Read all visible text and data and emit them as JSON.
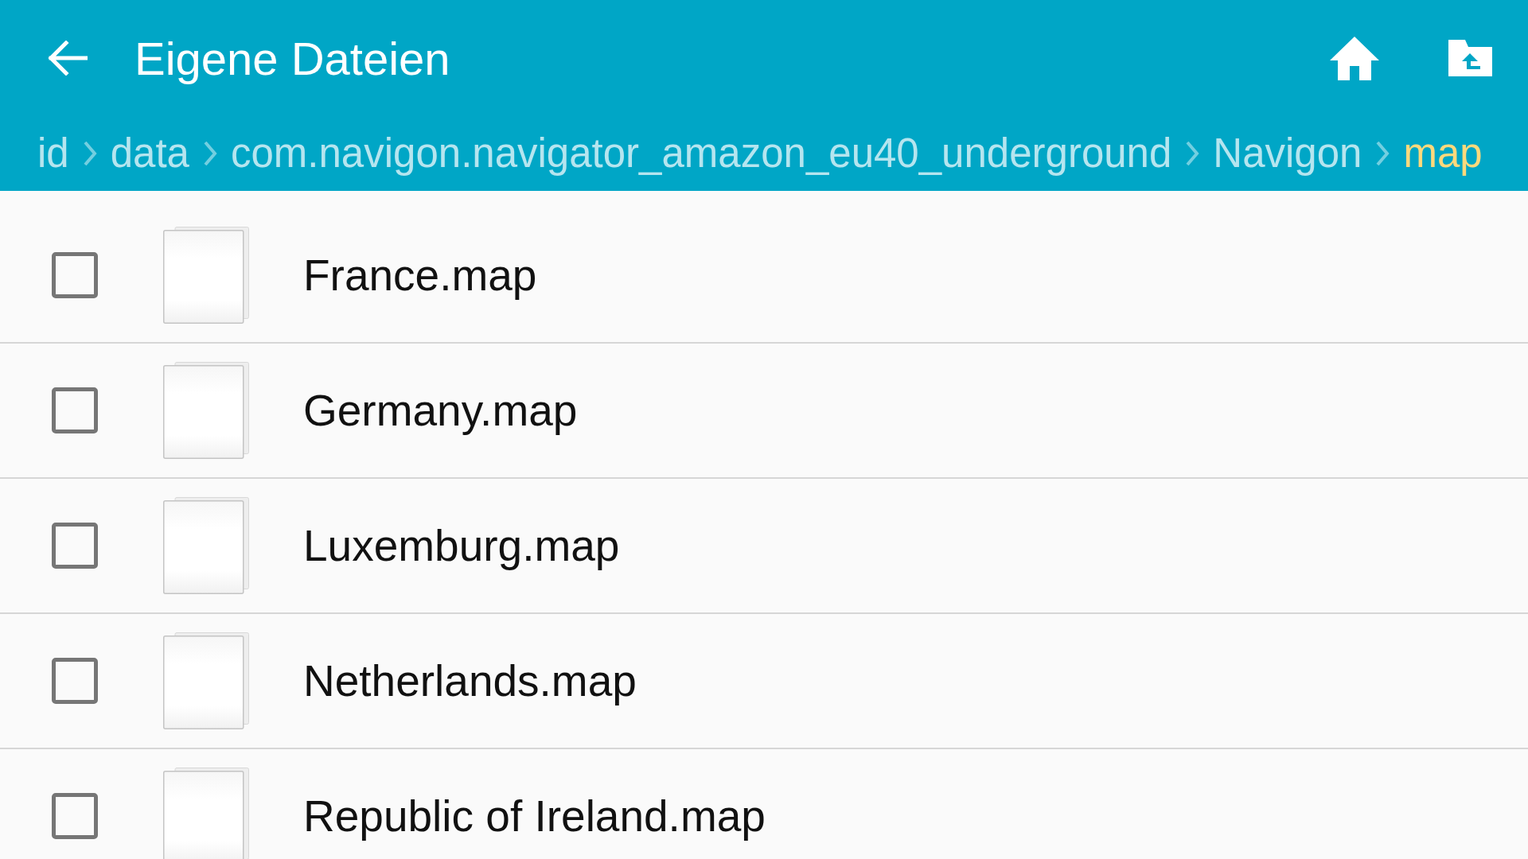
{
  "app_bar": {
    "title": "Eigene Dateien"
  },
  "breadcrumb": [
    {
      "label": "id",
      "selected": false
    },
    {
      "label": "data",
      "selected": false
    },
    {
      "label": "com.navigon.navigator_amazon_eu40_underground",
      "selected": false
    },
    {
      "label": "Navigon",
      "selected": false
    },
    {
      "label": "map",
      "selected": true
    }
  ],
  "files": [
    {
      "name": "France.map",
      "checked": false
    },
    {
      "name": "Germany.map",
      "checked": false
    },
    {
      "name": "Luxemburg.map",
      "checked": false
    },
    {
      "name": "Netherlands.map",
      "checked": false
    },
    {
      "name": "Republic of Ireland.map",
      "checked": false
    }
  ]
}
